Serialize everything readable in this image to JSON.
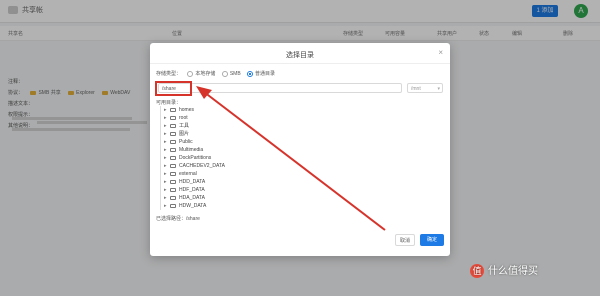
{
  "app": {
    "title": "共享帐",
    "header_button": "1 添加",
    "user_initial": "A"
  },
  "table_headers": [
    "共享名",
    "位置",
    "存储类型",
    "可用容量",
    "共享用户",
    "状态",
    "编辑",
    "删除"
  ],
  "info": {
    "title": "注释：",
    "rows": [
      {
        "label": "协议：",
        "tags": [
          "SMB 共享",
          "Explorer",
          "WebDAV"
        ]
      },
      {
        "label": "描述文本：",
        "bar_width": 120
      },
      {
        "label": "权限提示：",
        "bar_width": 118
      },
      {
        "label": "其他说明：",
        "bar_width": 110
      }
    ]
  },
  "modal": {
    "title": "选择目录",
    "close_icon": "×",
    "type_label": "存储类型：",
    "types": [
      {
        "label": "本地存储",
        "selected": false
      },
      {
        "label": "SMB",
        "selected": false
      },
      {
        "label": "普通目录",
        "selected": true
      }
    ],
    "path_value": "/share",
    "select_value": "/mnt",
    "section_label": "可用目录：",
    "tree": [
      "homes",
      "root",
      "工具",
      "图片",
      "Public",
      "Multimedia",
      "DockPartitions",
      "CACHEDEV2_DATA",
      "external",
      "HDD_DATA",
      "HDF_DATA",
      "HDA_DATA",
      "HDW_DATA"
    ],
    "selected_label": "已选择路径：/share",
    "cancel": "取消",
    "ok": "确定"
  },
  "watermark": {
    "badge": "值",
    "text": "什么值得买"
  },
  "colors": {
    "accent": "#1e7be6",
    "highlight": "#d6332b",
    "folder": "#e6b23a"
  }
}
